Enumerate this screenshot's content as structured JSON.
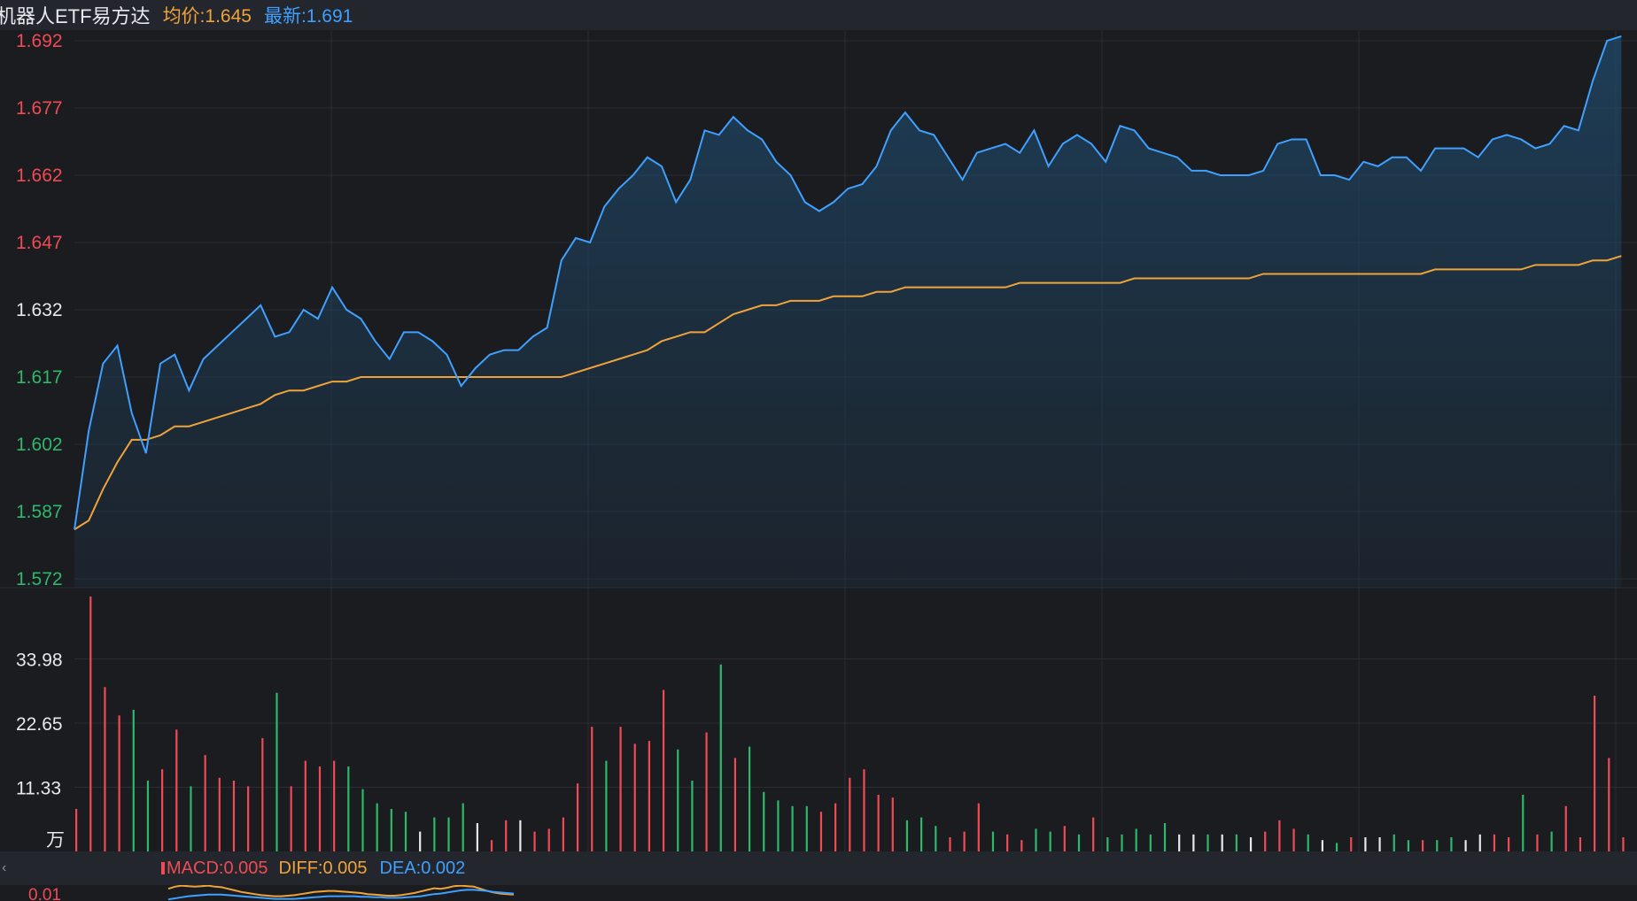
{
  "header": {
    "title": "机器人ETF易方达",
    "avg_label": "均价:1.645",
    "latest_label": "最新:1.691"
  },
  "indicator": {
    "collapse_glyph": "‹",
    "macd": "MACD:0.005",
    "diff": "DIFF:0.005",
    "dea": "DEA:0.002",
    "axis_tick": "0.01"
  },
  "colors": {
    "price_line": "#3fa0ff",
    "avg_line": "#f0a33a",
    "up": "#f04b54",
    "down": "#2fb76a",
    "flat": "#e8e8e8",
    "background": "#1a1c20",
    "grid": "#2a2d33"
  },
  "chart_data": [
    {
      "type": "line",
      "title": "",
      "xlabel": "",
      "ylabel": "",
      "ylim": [
        1.572,
        1.692
      ],
      "y_ticks": [
        "1.692",
        "1.677",
        "1.662",
        "1.647",
        "1.632",
        "1.617",
        "1.602",
        "1.587",
        "1.572"
      ],
      "y_tick_colors": [
        "up",
        "up",
        "up",
        "up",
        "flat",
        "down",
        "down",
        "down",
        "down"
      ],
      "x_total_minutes": 240,
      "series": [
        {
          "name": "最新",
          "color": "price_line",
          "values": [
            1.583,
            1.605,
            1.62,
            1.624,
            1.609,
            1.6,
            1.62,
            1.622,
            1.614,
            1.621,
            1.624,
            1.627,
            1.63,
            1.633,
            1.626,
            1.627,
            1.632,
            1.63,
            1.637,
            1.632,
            1.63,
            1.625,
            1.621,
            1.627,
            1.627,
            1.625,
            1.622,
            1.615,
            1.619,
            1.622,
            1.623,
            1.623,
            1.626,
            1.628,
            1.643,
            1.648,
            1.647,
            1.655,
            1.659,
            1.662,
            1.666,
            1.664,
            1.656,
            1.661,
            1.672,
            1.671,
            1.675,
            1.672,
            1.67,
            1.665,
            1.662,
            1.656,
            1.654,
            1.656,
            1.659,
            1.66,
            1.664,
            1.672,
            1.676,
            1.672,
            1.671,
            1.666,
            1.661,
            1.667,
            1.668,
            1.669,
            1.667,
            1.672,
            1.664,
            1.669,
            1.671,
            1.669,
            1.665,
            1.673,
            1.672,
            1.668,
            1.667,
            1.666,
            1.663,
            1.663,
            1.662,
            1.662,
            1.662,
            1.663,
            1.669,
            1.67,
            1.67,
            1.662,
            1.662,
            1.661,
            1.665,
            1.664,
            1.666,
            1.666,
            1.663,
            1.668,
            1.668,
            1.668,
            1.666,
            1.67,
            1.671,
            1.67,
            1.668,
            1.669,
            1.673,
            1.672,
            1.683,
            1.692,
            1.693
          ]
        },
        {
          "name": "均价",
          "color": "avg_line",
          "values": [
            1.583,
            1.585,
            1.592,
            1.598,
            1.603,
            1.603,
            1.604,
            1.606,
            1.606,
            1.607,
            1.608,
            1.609,
            1.61,
            1.611,
            1.613,
            1.614,
            1.614,
            1.615,
            1.616,
            1.616,
            1.617,
            1.617,
            1.617,
            1.617,
            1.617,
            1.617,
            1.617,
            1.617,
            1.617,
            1.617,
            1.617,
            1.617,
            1.617,
            1.617,
            1.617,
            1.618,
            1.619,
            1.62,
            1.621,
            1.622,
            1.623,
            1.625,
            1.626,
            1.627,
            1.627,
            1.629,
            1.631,
            1.632,
            1.633,
            1.633,
            1.634,
            1.634,
            1.634,
            1.635,
            1.635,
            1.635,
            1.636,
            1.636,
            1.637,
            1.637,
            1.637,
            1.637,
            1.637,
            1.637,
            1.637,
            1.637,
            1.638,
            1.638,
            1.638,
            1.638,
            1.638,
            1.638,
            1.638,
            1.638,
            1.639,
            1.639,
            1.639,
            1.639,
            1.639,
            1.639,
            1.639,
            1.639,
            1.639,
            1.64,
            1.64,
            1.64,
            1.64,
            1.64,
            1.64,
            1.64,
            1.64,
            1.64,
            1.64,
            1.64,
            1.64,
            1.641,
            1.641,
            1.641,
            1.641,
            1.641,
            1.641,
            1.641,
            1.642,
            1.642,
            1.642,
            1.642,
            1.643,
            1.643,
            1.644
          ]
        }
      ]
    },
    {
      "type": "bar",
      "title": "",
      "unit_label": "万",
      "ylim": [
        0,
        45.3
      ],
      "y_ticks": [
        "33.98",
        "22.65",
        "11.33"
      ],
      "series": [
        {
          "name": "",
          "values": [
            7.5,
            45,
            29,
            24,
            25,
            12.5,
            14.5,
            21.5,
            11.5,
            17,
            13,
            12.5,
            11.5,
            20,
            28,
            11.5,
            16,
            15,
            16,
            15,
            11,
            8.5,
            7.5,
            7,
            3.5,
            6,
            6,
            8.5,
            5,
            2,
            5.5,
            5.5,
            3.5,
            4,
            6,
            12,
            22,
            16,
            22,
            19,
            19.5,
            28.5,
            18,
            12.5,
            21,
            33,
            16.5,
            18.5,
            10.5,
            9,
            8,
            8,
            7,
            8.5,
            13,
            14.5,
            10,
            9.5,
            5.5,
            6,
            4.5,
            2.5,
            3.5,
            8.5,
            3.5,
            3,
            2,
            4,
            3.5,
            4.5,
            3,
            6,
            2.5,
            3,
            4,
            3,
            5,
            3,
            3,
            3,
            3,
            3,
            2.5,
            3.5,
            5.5,
            4,
            3,
            2,
            1.5,
            2.5,
            2.5,
            2.5,
            3,
            2,
            2,
            2,
            2.5,
            2,
            3,
            3,
            2.5,
            10,
            3,
            3.5,
            8,
            2.5,
            27.5,
            16.5,
            2.5
          ],
          "directions": [
            "up",
            "up",
            "up",
            "up",
            "down",
            "down",
            "up",
            "up",
            "down",
            "up",
            "up",
            "up",
            "up",
            "up",
            "down",
            "up",
            "up",
            "up",
            "up",
            "down",
            "down",
            "down",
            "down",
            "down",
            "flat",
            "down",
            "down",
            "down",
            "flat",
            "up",
            "up",
            "flat",
            "up",
            "up",
            "up",
            "up",
            "up",
            "down",
            "up",
            "up",
            "up",
            "up",
            "down",
            "down",
            "up",
            "down",
            "up",
            "down",
            "down",
            "down",
            "down",
            "down",
            "up",
            "up",
            "up",
            "up",
            "up",
            "up",
            "down",
            "down",
            "down",
            "up",
            "up",
            "up",
            "down",
            "up",
            "up",
            "down",
            "down",
            "up",
            "down",
            "up",
            "down",
            "down",
            "down",
            "down",
            "down",
            "flat",
            "flat",
            "down",
            "flat",
            "down",
            "flat",
            "up",
            "up",
            "up",
            "down",
            "flat",
            "down",
            "up",
            "flat",
            "flat",
            "down",
            "down",
            "up",
            "down",
            "down",
            "flat",
            "flat",
            "up",
            "up",
            "down",
            "up",
            "down",
            "up",
            "up",
            "up",
            "up",
            "up"
          ]
        }
      ]
    },
    {
      "type": "line",
      "title": "",
      "y_ticks": [
        "0.01"
      ],
      "series": [
        {
          "name": "DIFF",
          "color": "avg_line",
          "values": [
            0.0068,
            0.0072,
            0.0074,
            0.0073,
            0.0072,
            0.0073,
            0.0074,
            0.0072,
            0.0071,
            0.0068,
            0.0065,
            0.0062,
            0.006,
            0.0058,
            0.0056,
            0.0055,
            0.0054,
            0.0054,
            0.0055,
            0.0056,
            0.0058,
            0.006,
            0.0062,
            0.0063,
            0.0064,
            0.0064,
            0.0063,
            0.0062,
            0.0061,
            0.006,
            0.0058,
            0.0057,
            0.0056,
            0.0055,
            0.0055,
            0.0056,
            0.0058,
            0.006,
            0.0063,
            0.0066,
            0.0069,
            0.0068,
            0.007,
            0.0073,
            0.0074,
            0.0073,
            0.0072,
            0.0068,
            0.0064,
            0.0061,
            0.0059,
            0.0058,
            0.0057
          ]
        },
        {
          "name": "DEA",
          "color": "price_line",
          "values": [
            0.0048,
            0.005,
            0.0052,
            0.0054,
            0.0055,
            0.0056,
            0.0057,
            0.0057,
            0.0057,
            0.0056,
            0.0055,
            0.0054,
            0.0053,
            0.0052,
            0.0051,
            0.005,
            0.0049,
            0.0049,
            0.0049,
            0.0049,
            0.005,
            0.0051,
            0.0052,
            0.0053,
            0.0054,
            0.0054,
            0.0054,
            0.0054,
            0.0054,
            0.0053,
            0.0053,
            0.0052,
            0.0052,
            0.0051,
            0.0051,
            0.0051,
            0.0052,
            0.0053,
            0.0054,
            0.0056,
            0.0058,
            0.0059,
            0.0061,
            0.0063,
            0.0065,
            0.0066,
            0.0066,
            0.0065,
            0.0064,
            0.0062,
            0.0061,
            0.006,
            0.0059
          ]
        }
      ]
    }
  ]
}
